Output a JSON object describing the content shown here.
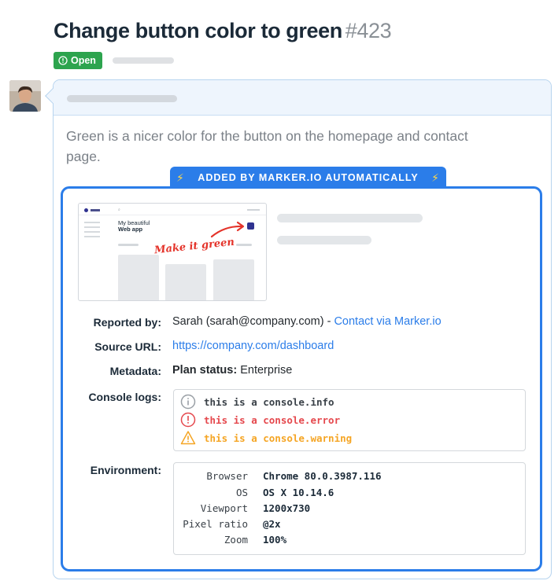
{
  "issue": {
    "title": "Change button color to green",
    "number": "#423",
    "status": "Open"
  },
  "comment": {
    "body": "Green is a nicer color for the button on the homepage and contact page."
  },
  "marker": {
    "tab_label": "ADDED BY MARKER.IO AUTOMATICALLY",
    "screenshot": {
      "hero_line1": "My beautiful",
      "hero_line2": "Web app",
      "annotation": "Make it green"
    },
    "reported_by": {
      "label": "Reported by:",
      "value": "Sarah (sarah@company.com) - ",
      "link": "Contact via Marker.io"
    },
    "source_url": {
      "label": "Source URL:",
      "value": "https://company.com/dashboard"
    },
    "metadata": {
      "label": "Metadata:",
      "key": "Plan status:",
      "value": "Enterprise"
    },
    "console_logs": {
      "label": "Console logs:",
      "entries": [
        {
          "type": "info",
          "text": "this is a console.info"
        },
        {
          "type": "error",
          "text": "this is a console.error"
        },
        {
          "type": "warning",
          "text": "this is a console.warning"
        }
      ]
    },
    "environment": {
      "label": "Environment:",
      "rows": [
        {
          "key": "Browser",
          "value": "Chrome 80.0.3987.116"
        },
        {
          "key": "OS",
          "value": "OS X 10.14.6"
        },
        {
          "key": "Viewport",
          "value": "1200x730"
        },
        {
          "key": "Pixel ratio",
          "value": "@2x"
        },
        {
          "key": "Zoom",
          "value": "100%"
        }
      ]
    }
  },
  "colors": {
    "accent": "#2b7de9",
    "open_badge": "#2da44e",
    "error": "#e5484d",
    "warning": "#f5a524",
    "annotation": "#e4332a"
  },
  "icons": [
    "issue-opened-icon",
    "bolt-icon",
    "info-icon",
    "error-icon",
    "warning-icon",
    "arrow-icon"
  ]
}
